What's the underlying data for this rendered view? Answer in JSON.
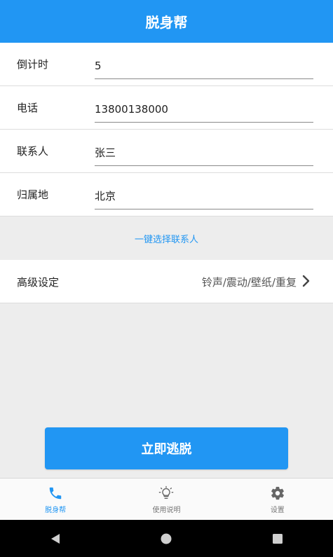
{
  "app": {
    "title": "脱身帮"
  },
  "form": {
    "rows": [
      {
        "label": "倒计时",
        "value": "5"
      },
      {
        "label": "电话",
        "value": "13800138000"
      },
      {
        "label": "联系人",
        "value": "张三"
      },
      {
        "label": "归属地",
        "value": "北京"
      }
    ]
  },
  "pick_contact": {
    "label": "一键选择联系人"
  },
  "advanced": {
    "label": "高级设定",
    "value": "铃声/震动/壁纸/重复",
    "icon": "chevron-right-icon"
  },
  "escape_button": {
    "label": "立即逃脱"
  },
  "bottom_nav": {
    "items": [
      {
        "label": "脱身帮",
        "icon": "phone-icon",
        "active": true
      },
      {
        "label": "使用说明",
        "icon": "lightbulb-icon",
        "active": false
      },
      {
        "label": "设置",
        "icon": "gear-icon",
        "active": false
      }
    ]
  },
  "system_nav": {
    "back_icon": "back-triangle-icon",
    "home_icon": "home-circle-icon",
    "recents_icon": "recents-square-icon"
  },
  "colors": {
    "primary": "#2196f3",
    "background": "#ededed",
    "surface": "#ffffff"
  }
}
